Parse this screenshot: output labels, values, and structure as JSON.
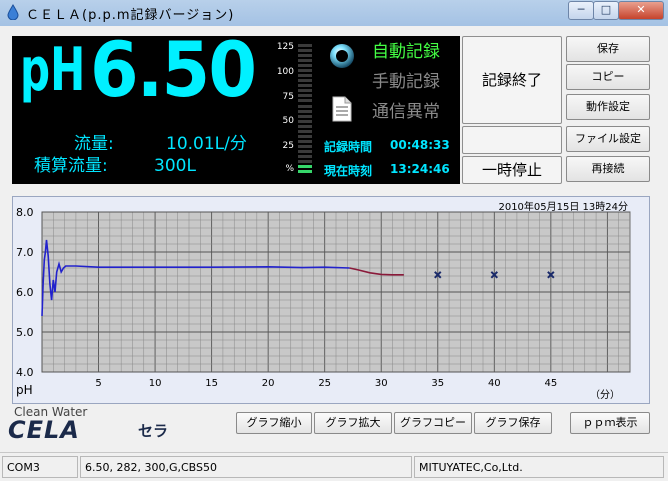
{
  "window": {
    "title": "ＣＥＬＡ(p.p.m記録バージョン)",
    "min_glyph": "─",
    "max_glyph": "□",
    "close_glyph": "✕"
  },
  "display": {
    "ph_label": "pH",
    "ph_value": "6.50",
    "flow_label": "流量:",
    "flow_value": "10.01L/分",
    "total_label": "積算流量:",
    "total_value": "300L",
    "scale_labels": [
      "125",
      "100",
      "75",
      "50",
      "25",
      "%"
    ],
    "scale_level_percent": 10,
    "status_auto": "自動記録",
    "status_manual": "手動記録",
    "status_comm_error": "通信異常",
    "record_time_label": "記録時間",
    "record_time": "00:48:33",
    "current_time_label": "現在時刻",
    "current_time": "13:24:46",
    "colors": {
      "cyan": "#00f0ff",
      "active_green": "#44ff44",
      "inactive_gray": "#8a8a8a"
    }
  },
  "controls": {
    "stop_record": "記録終了",
    "pause": "一時停止",
    "save": "保存",
    "copy": "コピー",
    "operation_settings": "動作設定",
    "file_settings": "ファイル設定",
    "reconnect": "再接続"
  },
  "graph_buttons": {
    "shrink": "グラフ縮小",
    "enlarge": "グラフ拡大",
    "copy": "グラフコピー",
    "save": "グラフ保存",
    "ppm": "ｐｐｍ表示"
  },
  "brand": {
    "line1": "Clean Water",
    "line2": "CELA",
    "line3": "セラ"
  },
  "statusbar": {
    "port": "COM3",
    "values": "6.50, 282,  300,G,CBS50",
    "company": "MITUYATEC,Co,Ltd."
  },
  "chart_data": {
    "type": "line",
    "datetime": "2010年05月15日  13時24分",
    "ylabel": "pH",
    "xlabel": "（分）",
    "xlim": [
      0,
      52
    ],
    "ylim": [
      4.0,
      8.0
    ],
    "x_ticks": [
      "5",
      "10",
      "15",
      "20",
      "25",
      "30",
      "35",
      "40",
      "45"
    ],
    "y_ticks": [
      "4.0",
      "5.0",
      "6.0",
      "7.0",
      "8.0"
    ],
    "grid": true,
    "series": [
      {
        "color": "#2222cc",
        "x": [
          0.0,
          0.1,
          0.2,
          0.3,
          0.4,
          0.55,
          0.7,
          0.85,
          1.0,
          1.15,
          1.3,
          1.5,
          1.7,
          1.9,
          2.1,
          2.4,
          3,
          5,
          10,
          15,
          20,
          23,
          25,
          27.2
        ],
        "y": [
          5.4,
          6.2,
          6.8,
          7.0,
          7.3,
          6.9,
          6.2,
          5.8,
          6.3,
          6.0,
          6.5,
          6.7,
          6.5,
          6.6,
          6.65,
          6.65,
          6.65,
          6.62,
          6.62,
          6.62,
          6.63,
          6.61,
          6.62,
          6.6
        ]
      },
      {
        "color": "#8a1a3a",
        "x": [
          27.2,
          28.0,
          29.0,
          30.0,
          31.0,
          32.0
        ],
        "y": [
          6.6,
          6.55,
          6.48,
          6.44,
          6.43,
          6.43
        ]
      }
    ],
    "markers": [
      {
        "x": 35,
        "y": 6.43
      },
      {
        "x": 40,
        "y": 6.43
      },
      {
        "x": 45,
        "y": 6.43
      }
    ]
  }
}
